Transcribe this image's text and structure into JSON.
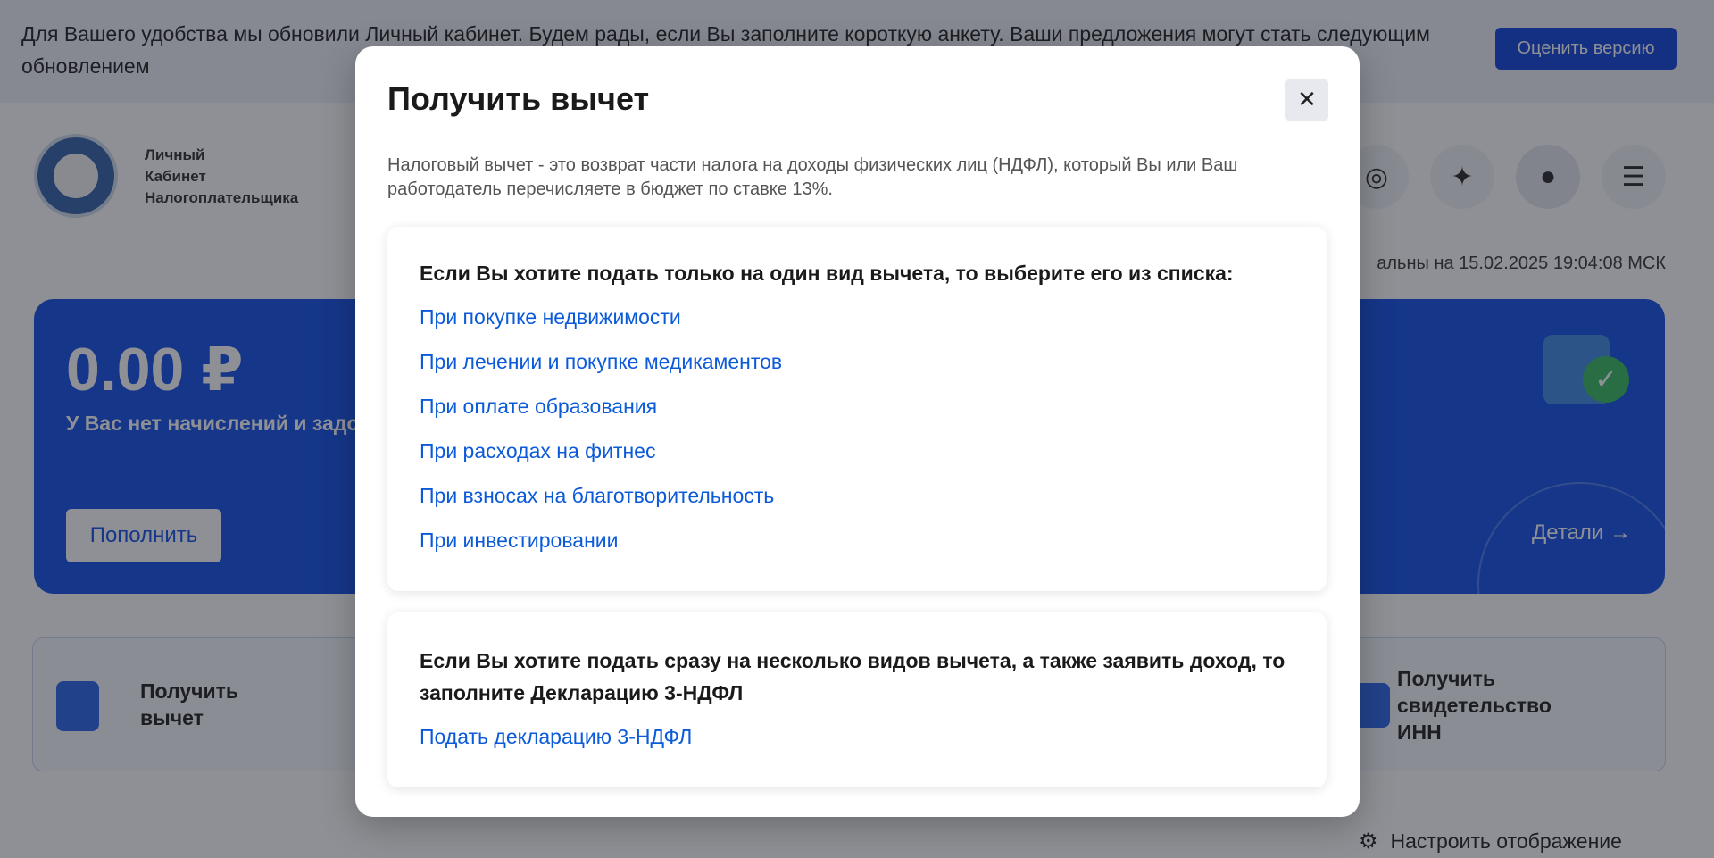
{
  "banner": {
    "text": "Для Вашего удобства мы обновили Личный кабинет. Будем рады, если Вы заполните короткую анкету. Ваши предложения могут стать следующим обновлением",
    "button": "Оценить версию"
  },
  "header": {
    "logo_line1": "Личный",
    "logo_line2": "Кабинет",
    "logo_line3": "Налогоплательщика",
    "icons": [
      "eye-off-icon",
      "lightbulb-icon",
      "user-icon",
      "menu-icon"
    ],
    "updated": "альны на 15.02.2025 19:04:08 МСК"
  },
  "balance": {
    "amount": "0.00 ₽",
    "subtitle": "У Вас нет начислений и задо",
    "topup": "Пополнить",
    "details": "Детали"
  },
  "tiles": {
    "left_line1": "Получить",
    "left_line2": "вычет",
    "right_line1": "Получить",
    "right_line2": "свидетельство",
    "right_line3": "ИНН"
  },
  "footer": {
    "customize": "Настроить отображение"
  },
  "modal": {
    "title": "Получить вычет",
    "description": "Налоговый вычет - это возврат части налога на доходы физических лиц (НДФЛ), который Вы или Ваш работодатель перечисляете в бюджет по ставке 13%.",
    "section1": {
      "heading": "Если Вы хотите подать только на один вид вычета, то выберите его из списка:",
      "links": [
        "При покупке недвижимости",
        "При лечении и покупке медикаментов",
        "При оплате образования",
        "При расходах на фитнес",
        "При взносах на благотворительность",
        "При инвестировании"
      ]
    },
    "section2": {
      "heading": "Если Вы хотите подать сразу на несколько видов вычета, а также заявить доход, то заполните Декларацию 3-НДФЛ",
      "link": "Подать декларацию 3-НДФЛ"
    }
  },
  "colors": {
    "accent": "#0b3eda",
    "link": "#0b5ad9",
    "card": "#0d4be6"
  }
}
